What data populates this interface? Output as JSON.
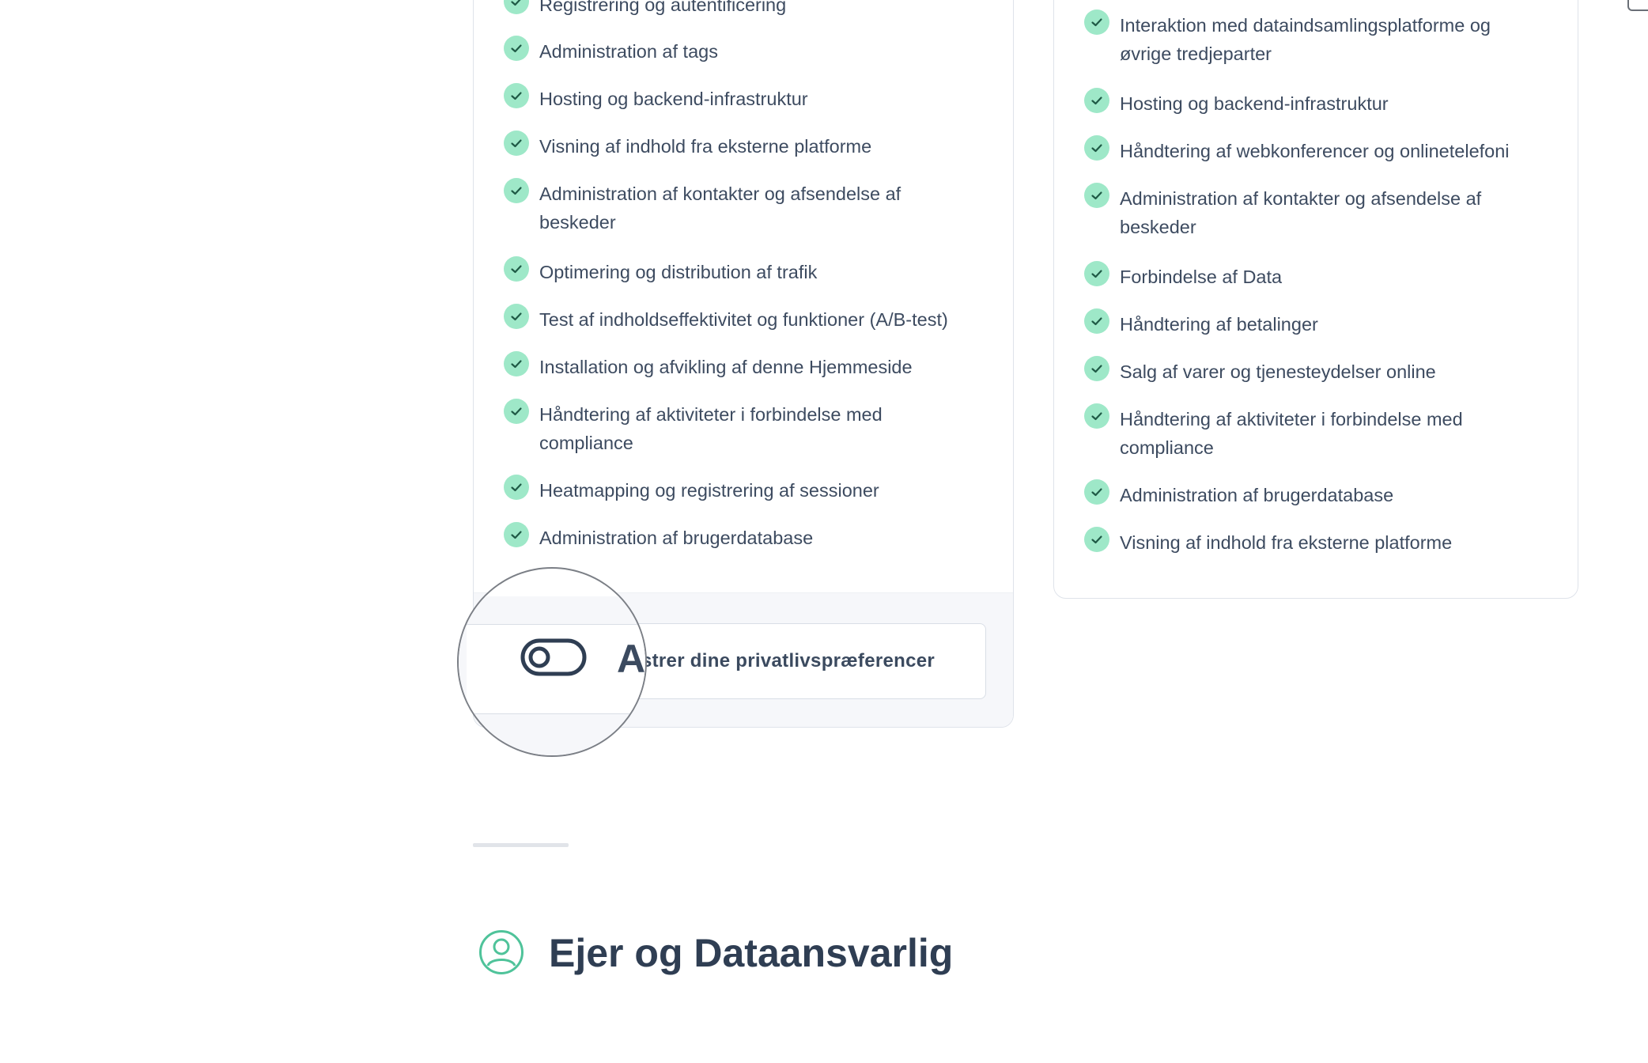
{
  "left_card": {
    "items": [
      "Registrering og autentificering",
      "Administration af tags",
      "Hosting og backend-infrastruktur",
      "Visning af indhold fra eksterne platforme",
      "Administration af kontakter og afsendelse af\nbeskeder",
      "Optimering og distribution af trafik",
      "Test af indholdseffektivitet og funktioner (A/B-test)",
      "Installation og afvikling af denne Hjemmeside",
      "Håndtering af aktiviteter i forbindelse med\ncompliance",
      "Heatmapping og registrering af sessioner",
      "Administration af brugerdatabase"
    ],
    "prefs_button_label": "istrer dine privatlivspræferencer",
    "magnified_letter": "A"
  },
  "right_card": {
    "items": [
      "Interaktion med dataindsamlingsplatforme og\nøvrige tredjeparter",
      "Hosting og backend-infrastruktur",
      "Håndtering af webkonferencer og onlinetelefoni",
      "Administration af kontakter og afsendelse af\nbeskeder",
      "Forbindelse af Data",
      "Håndtering af betalinger",
      "Salg af varer og tjenesteydelser online",
      "Håndtering af aktiviteter i forbindelse med\ncompliance",
      "Administration af brugerdatabase",
      "Visning af indhold fra eksterne platforme"
    ]
  },
  "section": {
    "title": "Ejer og Dataansvarlig",
    "icon": "user-circle-icon"
  },
  "colors": {
    "check_bg": "#9ee8c8",
    "check_mark": "#1f5a46",
    "accent_green": "#4fc39a",
    "text": "#3d4b60",
    "heading": "#2f3e53"
  }
}
